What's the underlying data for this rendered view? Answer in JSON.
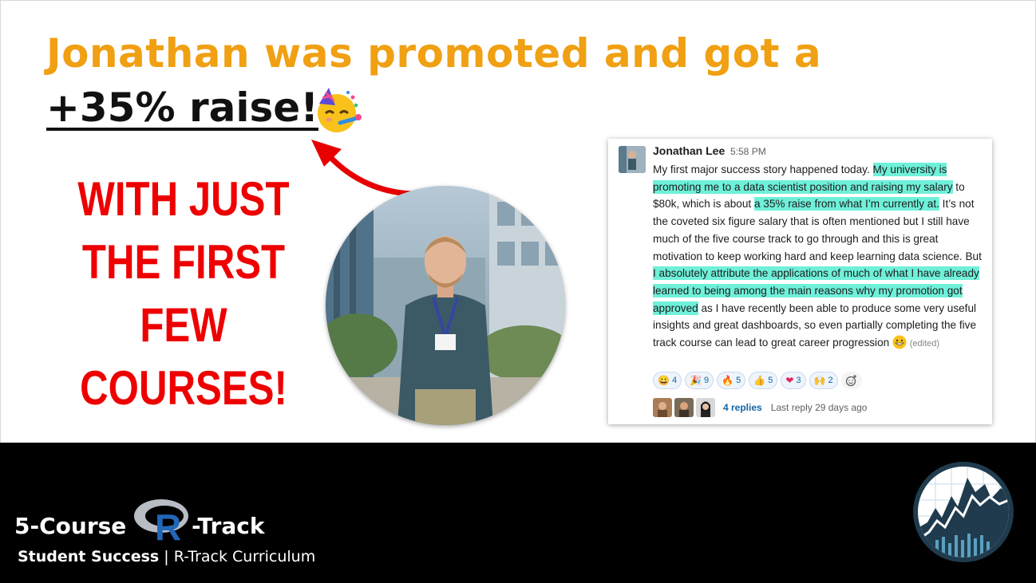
{
  "headline": {
    "line1": "Jonathan was promoted and got a",
    "line2": "+35% raise!",
    "emoji_icon": "partying-face-icon"
  },
  "callout": {
    "lines": [
      "WITH JUST",
      "THE FIRST",
      "FEW",
      "COURSES!"
    ],
    "color": "#ee0000"
  },
  "message": {
    "author": "Jonathan Lee",
    "time": "5:58 PM",
    "segments": [
      {
        "text": "My first major success story happened today. ",
        "highlight": false
      },
      {
        "text": "My university is promoting me to a data scientist position and raising my salary",
        "highlight": true
      },
      {
        "text": " to $80k, which is about ",
        "highlight": false
      },
      {
        "text": "a 35% raise from what I’m currently at.",
        "highlight": true
      },
      {
        "text": " It’s not the coveted six figure salary that is often mentioned but I still have much of the five course track to go through and this is great motivation to keep working hard and keep learning data science. But ",
        "highlight": false
      },
      {
        "text": "I absolutely attribute the applications of much of what I have already learned to being among the main reasons why my promotion got approved",
        "highlight": true
      },
      {
        "text": " as I have recently been able to produce some very useful insights and great dashboards, so even partially completing the five track course can lead to great career progression ",
        "highlight": false
      }
    ],
    "end_emoji_icon": "grinning-face-icon",
    "edited_label": "(edited)",
    "highlight_color": "#6ff0d9",
    "reactions": [
      {
        "icon": "smiley-icon",
        "glyph": "😀",
        "count": "4"
      },
      {
        "icon": "party-popper-icon",
        "glyph": "🎉",
        "count": "9"
      },
      {
        "icon": "fire-icon",
        "glyph": "🔥",
        "count": "5"
      },
      {
        "icon": "thumbs-up-icon",
        "glyph": "👍",
        "count": "5"
      },
      {
        "icon": "heart-icon",
        "glyph": "❤",
        "count": "3"
      },
      {
        "icon": "raised-hands-icon",
        "glyph": "🙌",
        "count": "2"
      }
    ],
    "add_reaction_icon": "add-reaction-icon",
    "replies_label": "4 replies",
    "last_reply": "Last reply 29 days ago"
  },
  "footer": {
    "track_prefix": "5-Course",
    "track_letter": "R",
    "track_suffix": "-Track",
    "subtitle_bold": "Student Success",
    "subtitle_rest": " | R-Track Curriculum"
  }
}
